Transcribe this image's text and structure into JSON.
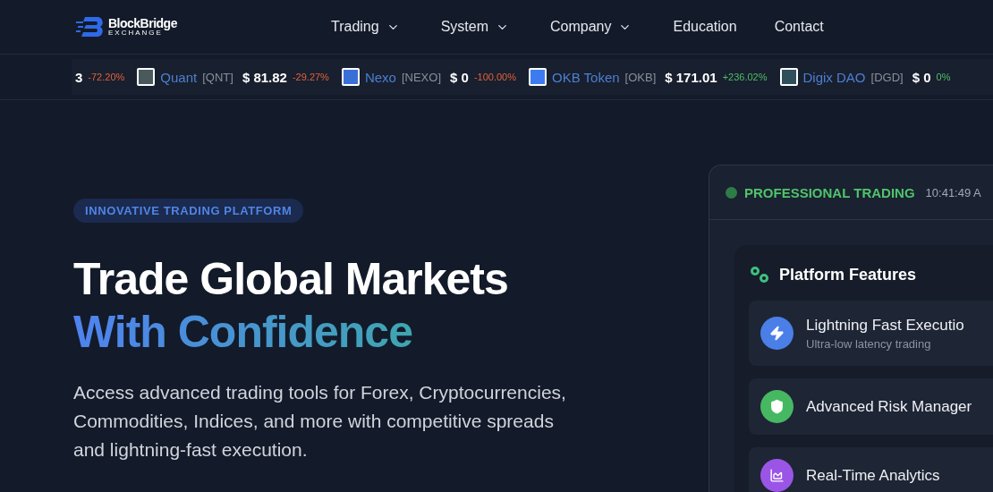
{
  "header": {
    "logo": {
      "name": "BlockBridge",
      "tagline": "EXCHANGE"
    },
    "nav": [
      {
        "label": "Trading",
        "dropdown": true
      },
      {
        "label": "System",
        "dropdown": true
      },
      {
        "label": "Company",
        "dropdown": true
      },
      {
        "label": "Education",
        "dropdown": false
      },
      {
        "label": "Contact",
        "dropdown": false
      }
    ]
  },
  "ticker": [
    {
      "price": "3",
      "change": "-72.20%",
      "rising": false
    },
    {
      "name": "Quant",
      "symbol": "[QNT]",
      "price": "$ 81.82",
      "change": "-29.27%",
      "rising": false,
      "color": "#4a5a5c"
    },
    {
      "name": "Nexo",
      "symbol": "[NEXO]",
      "price": "$ 0",
      "change": "-100.00%",
      "rising": false,
      "color": "#3b6fd8"
    },
    {
      "name": "OKB Token",
      "symbol": "[OKB]",
      "price": "$ 171.01",
      "change": "+236.02%",
      "rising": true,
      "color": "#3d7cf0"
    },
    {
      "name": "Digix DAO",
      "symbol": "[DGD]",
      "price": "$ 0",
      "change": "0%",
      "rising": true,
      "color": "#2f4f5a"
    }
  ],
  "hero": {
    "badge": "INNOVATIVE TRADING PLATFORM",
    "title": "Trade Global Markets",
    "title_accent": "With Confidence",
    "description": "Access advanced trading tools for Forex, Cryptocurrencies, Commodities, Indices, and more with competitive spreads and lightning-fast execution."
  },
  "panel": {
    "status": "PROFESSIONAL TRADING",
    "live": true,
    "time": "10:41:49 A",
    "features_title": "Platform Features",
    "features": [
      {
        "kind": "bolt",
        "title": "Lightning Fast Executio",
        "subtitle": "Ultra-low latency trading",
        "color": "#4a7fe8"
      },
      {
        "kind": "shield",
        "title": "Advanced Risk Manager",
        "color": "#47b862"
      },
      {
        "kind": "chart",
        "title": "Real-Time Analytics",
        "color": "#9a55e6"
      }
    ]
  }
}
